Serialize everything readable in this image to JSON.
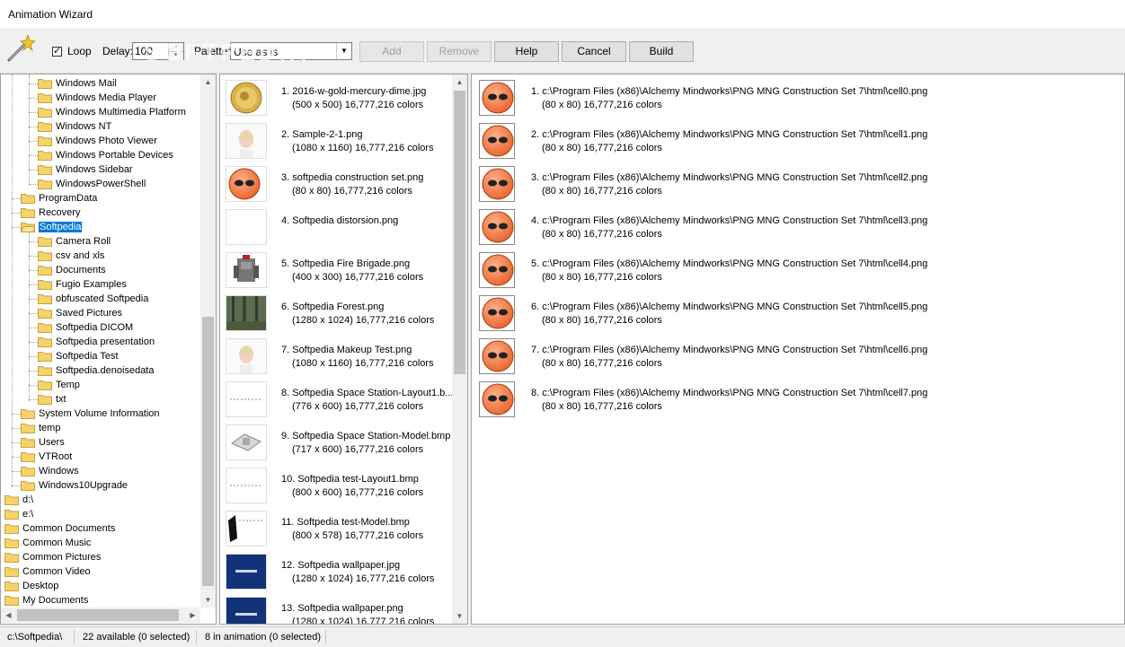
{
  "window": {
    "title": "Animation Wizard"
  },
  "toolbar": {
    "loop_label": "Loop",
    "loop_checked": true,
    "delay_label": "Delay:",
    "delay_value": "100",
    "palette_label": "Palette:",
    "palette_value": "Use as is",
    "add_label": "Add",
    "remove_label": "Remove",
    "help_label": "Help",
    "cancel_label": "Cancel",
    "build_label": "Build"
  },
  "tree": {
    "items": [
      {
        "label": "Windows Mail",
        "level": 2
      },
      {
        "label": "Windows Media Player",
        "level": 2
      },
      {
        "label": "Windows Multimedia Platform",
        "level": 2
      },
      {
        "label": "Windows NT",
        "level": 2
      },
      {
        "label": "Windows Photo Viewer",
        "level": 2
      },
      {
        "label": "Windows Portable Devices",
        "level": 2
      },
      {
        "label": "Windows Sidebar",
        "level": 2
      },
      {
        "label": "WindowsPowerShell",
        "level": 2
      },
      {
        "label": "ProgramData",
        "level": 1
      },
      {
        "label": "Recovery",
        "level": 1
      },
      {
        "label": "Softpedia",
        "level": 1,
        "selected": true
      },
      {
        "label": "Camera Roll",
        "level": 2
      },
      {
        "label": "csv and xls",
        "level": 2
      },
      {
        "label": "Documents",
        "level": 2
      },
      {
        "label": "Fugio Examples",
        "level": 2
      },
      {
        "label": "obfuscated Softpedia",
        "level": 2
      },
      {
        "label": "Saved Pictures",
        "level": 2
      },
      {
        "label": "Softpedia DICOM",
        "level": 2
      },
      {
        "label": "Softpedia presentation",
        "level": 2
      },
      {
        "label": "Softpedia Test",
        "level": 2
      },
      {
        "label": "Softpedia.denoisedata",
        "level": 2
      },
      {
        "label": "Temp",
        "level": 2
      },
      {
        "label": "txt",
        "level": 2
      },
      {
        "label": "System Volume Information",
        "level": 1
      },
      {
        "label": "temp",
        "level": 1
      },
      {
        "label": "Users",
        "level": 1
      },
      {
        "label": "VTRoot",
        "level": 1
      },
      {
        "label": "Windows",
        "level": 1
      },
      {
        "label": "Windows10Upgrade",
        "level": 1
      },
      {
        "label": "d:\\",
        "level": 0
      },
      {
        "label": "e:\\",
        "level": 0
      },
      {
        "label": "Common Documents",
        "level": 0
      },
      {
        "label": "Common Music",
        "level": 0
      },
      {
        "label": "Common Pictures",
        "level": 0
      },
      {
        "label": "Common Video",
        "level": 0
      },
      {
        "label": "Desktop",
        "level": 0
      },
      {
        "label": "My Documents",
        "level": 0
      }
    ]
  },
  "available": {
    "items": [
      {
        "name": "1. 2016-w-gold-mercury-dime.jpg",
        "info": "(500 x 500) 16,777,216 colors",
        "thumb": "coin"
      },
      {
        "name": "2. Sample-2-1.png",
        "info": "(1080 x 1160) 16,777,216 colors",
        "thumb": "face"
      },
      {
        "name": "3. softpedia construction set.png",
        "info": "(80 x 80) 16,777,216 colors",
        "thumb": "ball"
      },
      {
        "name": "4. Softpedia distorsion.png",
        "info": "",
        "thumb": "blank"
      },
      {
        "name": "5. Softpedia Fire Brigade.png",
        "info": "(400 x 300) 16,777,216 colors",
        "thumb": "robot"
      },
      {
        "name": "6. Softpedia Forest.png",
        "info": "(1280 x 1024) 16,777,216 colors",
        "thumb": "forest"
      },
      {
        "name": "7. Softpedia Makeup Test.png",
        "info": "(1080 x 1160) 16,777,216 colors",
        "thumb": "face"
      },
      {
        "name": "8. Softpedia Space Station-Layout1.b...",
        "info": "(776 x 600) 16,777,216 colors",
        "thumb": "layout"
      },
      {
        "name": "9. Softpedia Space Station-Model.bmp",
        "info": "(717 x 600) 16,777,216 colors",
        "thumb": "model"
      },
      {
        "name": "10. Softpedia test-Layout1.bmp",
        "info": "(800 x 600) 16,777,216 colors",
        "thumb": "layout"
      },
      {
        "name": "11. Softpedia test-Model.bmp",
        "info": "(800 x 578) 16,777,216 colors",
        "thumb": "testmodel"
      },
      {
        "name": "12. Softpedia wallpaper.jpg",
        "info": "(1280 x 1024) 16,777,216 colors",
        "thumb": "wallpaper"
      },
      {
        "name": "13. Softpedia wallpaper.png",
        "info": "(1280 x 1024) 16,777,216 colors",
        "thumb": "wallpaper"
      }
    ]
  },
  "animation": {
    "items": [
      {
        "name": "1. c:\\Program Files (x86)\\Alchemy Mindworks\\PNG MNG Construction Set 7\\html\\cell0.png",
        "info": "(80 x 80) 16,777,216 colors",
        "thumb": "ball"
      },
      {
        "name": "2. c:\\Program Files (x86)\\Alchemy Mindworks\\PNG MNG Construction Set 7\\html\\cell1.png",
        "info": "(80 x 80) 16,777,216 colors",
        "thumb": "ball"
      },
      {
        "name": "3. c:\\Program Files (x86)\\Alchemy Mindworks\\PNG MNG Construction Set 7\\html\\cell2.png",
        "info": "(80 x 80) 16,777,216 colors",
        "thumb": "ball"
      },
      {
        "name": "4. c:\\Program Files (x86)\\Alchemy Mindworks\\PNG MNG Construction Set 7\\html\\cell3.png",
        "info": "(80 x 80) 16,777,216 colors",
        "thumb": "ball"
      },
      {
        "name": "5. c:\\Program Files (x86)\\Alchemy Mindworks\\PNG MNG Construction Set 7\\html\\cell4.png",
        "info": "(80 x 80) 16,777,216 colors",
        "thumb": "ball"
      },
      {
        "name": "6. c:\\Program Files (x86)\\Alchemy Mindworks\\PNG MNG Construction Set 7\\html\\cell5.png",
        "info": "(80 x 80) 16,777,216 colors",
        "thumb": "ball"
      },
      {
        "name": "7. c:\\Program Files (x86)\\Alchemy Mindworks\\PNG MNG Construction Set 7\\html\\cell6.png",
        "info": "(80 x 80) 16,777,216 colors",
        "thumb": "ball"
      },
      {
        "name": "8. c:\\Program Files (x86)\\Alchemy Mindworks\\PNG MNG Construction Set 7\\html\\cell7.png",
        "info": "(80 x 80) 16,777,216 colors",
        "thumb": "ball"
      }
    ]
  },
  "status": {
    "path": "c:\\Softpedia\\",
    "available": "22 available (0 selected)",
    "in_animation": "8 in animation (0 selected)"
  },
  "watermark": {
    "text": "SOFTPEDIA"
  },
  "colors": {
    "selection": "#0078d7",
    "folder": "#f5d36b",
    "ball": "#e8622a"
  }
}
